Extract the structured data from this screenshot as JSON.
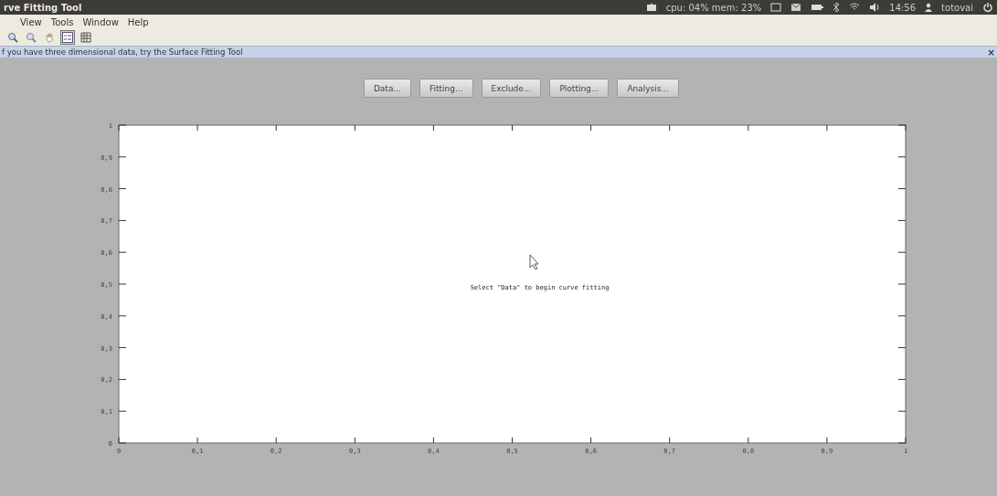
{
  "window": {
    "title": "rve Fitting Tool"
  },
  "panel": {
    "system_monitor": "cpu: 04% mem: 23%",
    "clock": "14:56",
    "user": "totovai"
  },
  "menu": [
    "View",
    "Tools",
    "Window",
    "Help"
  ],
  "toolbar": [
    {
      "kind": "zoom-in",
      "selected": false
    },
    {
      "kind": "zoom-out",
      "selected": false
    },
    {
      "kind": "pan",
      "selected": false
    },
    {
      "kind": "legend",
      "selected": true
    },
    {
      "kind": "grid",
      "selected": false
    }
  ],
  "info_bar": {
    "text": "f you have three dimensional data, try the Surface Fitting Tool",
    "close": "×"
  },
  "buttons": [
    "Data...",
    "Fitting...",
    "Exclude...",
    "Plotting...",
    "Analysis..."
  ],
  "plot": {
    "message": "Select \"Data\" to begin curve fitting",
    "chart_data": {
      "type": "line",
      "xlim": [
        0,
        1
      ],
      "ylim": [
        0,
        1
      ],
      "xticks": [
        {
          "value": 0,
          "label": "0"
        },
        {
          "value": 0.1,
          "label": "0,1"
        },
        {
          "value": 0.2,
          "label": "0,2"
        },
        {
          "value": 0.3,
          "label": "0,3"
        },
        {
          "value": 0.4,
          "label": "0,4"
        },
        {
          "value": 0.5,
          "label": "0,5"
        },
        {
          "value": 0.6,
          "label": "0,6"
        },
        {
          "value": 0.7,
          "label": "0,7"
        },
        {
          "value": 0.8,
          "label": "0,8"
        },
        {
          "value": 0.9,
          "label": "0,9"
        },
        {
          "value": 1,
          "label": "1"
        }
      ],
      "yticks": [
        {
          "value": 0,
          "label": "0"
        },
        {
          "value": 0.1,
          "label": "0,1"
        },
        {
          "value": 0.2,
          "label": "0,2"
        },
        {
          "value": 0.3,
          "label": "0,3"
        },
        {
          "value": 0.4,
          "label": "0,4"
        },
        {
          "value": 0.5,
          "label": "0,5"
        },
        {
          "value": 0.6,
          "label": "0,6"
        },
        {
          "value": 0.7,
          "label": "0,7"
        },
        {
          "value": 0.8,
          "label": "0,8"
        },
        {
          "value": 0.9,
          "label": "0,9"
        },
        {
          "value": 1,
          "label": "1"
        }
      ]
    }
  }
}
